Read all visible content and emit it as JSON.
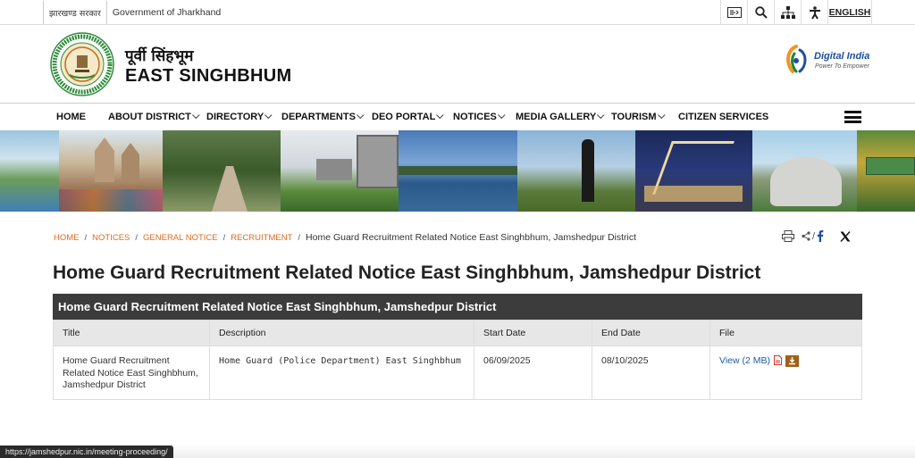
{
  "topbar": {
    "gov_hindi": "झारखण्ड सरकार",
    "gov_english": "Government of Jharkhand",
    "tools": [
      "skip-to-content-icon",
      "search-icon",
      "sitemap-icon",
      "accessibility-icon"
    ],
    "language": "ENGLISH"
  },
  "header": {
    "site_name_hindi": "पूर्वी सिंहभूम",
    "site_name_english": "EAST SINGHBHUM",
    "digital_india": {
      "title": "Digital India",
      "tagline": "Power To Empower"
    }
  },
  "nav": {
    "items": [
      {
        "label": "HOME",
        "dropdown": false
      },
      {
        "label": "ABOUT DISTRICT",
        "dropdown": true
      },
      {
        "label": "DIRECTORY",
        "dropdown": true
      },
      {
        "label": "DEPARTMENTS",
        "dropdown": true
      },
      {
        "label": "DEO PORTAL",
        "dropdown": true
      },
      {
        "label": "NOTICES",
        "dropdown": true
      },
      {
        "label": "MEDIA GALLERY",
        "dropdown": true
      },
      {
        "label": "TOURISM",
        "dropdown": true
      },
      {
        "label": "CITIZEN SERVICES",
        "dropdown": false
      }
    ]
  },
  "breadcrumb": {
    "links": [
      "HOME",
      "NOTICES",
      "GENERAL NOTICE",
      "RECRUITMENT"
    ],
    "current": "Home Guard Recruitment Related Notice East Singhbhum, Jamshedpur District"
  },
  "page": {
    "title": "Home Guard Recruitment Related Notice East Singhbhum, Jamshedpur District"
  },
  "table": {
    "caption": "Home Guard Recruitment Related Notice East Singhbhum, Jamshedpur District",
    "headers": [
      "Title",
      "Description",
      "Start Date",
      "End Date",
      "File"
    ],
    "rows": [
      {
        "title": "Home Guard Recruitment Related Notice East Singhbhum, Jamshedpur District",
        "description": "Home Guard (Police Department) East Singhbhum",
        "start_date": "06/09/2025",
        "end_date": "08/10/2025",
        "file_label": "View (2 MB)"
      }
    ]
  },
  "statusbar": {
    "url": "https://jamshedpur.nic.in/meeting-proceeding/"
  },
  "colors": {
    "breadcrumb_link": "#e06a1c",
    "caption_bg": "#3c3c3c",
    "link": "#1d5aa8"
  }
}
